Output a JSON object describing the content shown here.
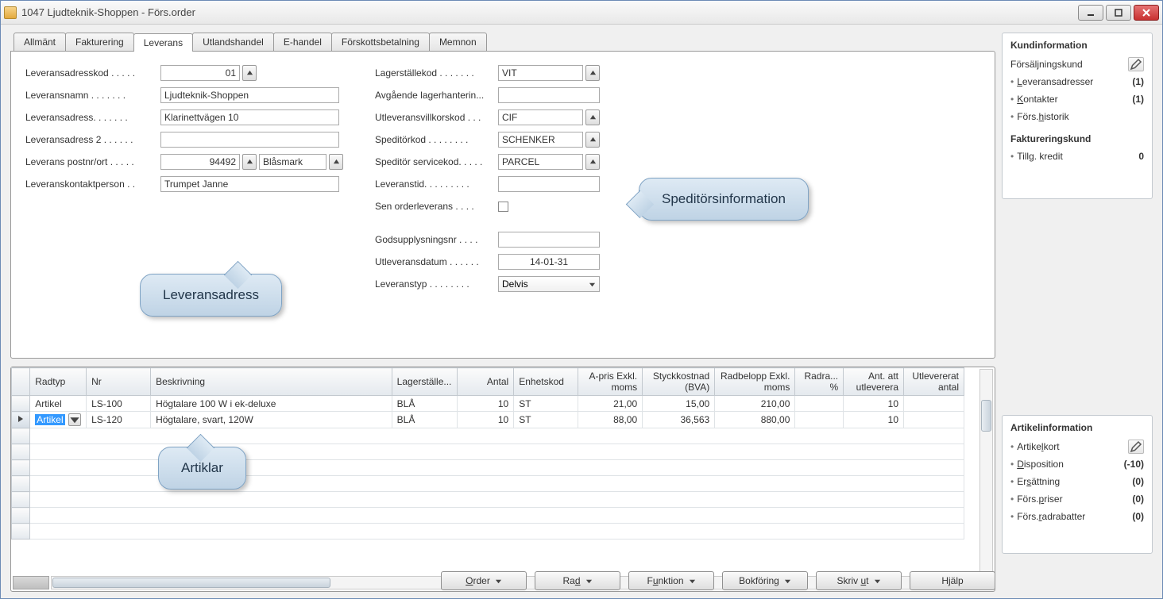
{
  "window": {
    "title": "1047 Ljudteknik-Shoppen - Förs.order"
  },
  "tabs": [
    "Allmänt",
    "Fakturering",
    "Leverans",
    "Utlandshandel",
    "E-handel",
    "Förskottsbetalning",
    "Memnon"
  ],
  "active_tab_index": 2,
  "form_left": {
    "leveransadresskod": {
      "label": "Leveransadresskod . . . . .",
      "value": "01"
    },
    "leveransnamn": {
      "label": "Leveransnamn . . . . . . .",
      "value": "Ljudteknik-Shoppen"
    },
    "leveransadress": {
      "label": "Leveransadress. . . . . . .",
      "value": "Klarinettvägen 10"
    },
    "leveransadress2": {
      "label": "Leveransadress 2 . . . . . .",
      "value": ""
    },
    "postnr": {
      "label": "Leverans postnr/ort . . . . .",
      "value": "94492",
      "ort": "Blåsmark"
    },
    "kontakt": {
      "label": "Leveranskontaktperson . .",
      "value": "Trumpet Janne"
    }
  },
  "form_right": {
    "lagerstallekod": {
      "label": "Lagerställekod  . . . . . . .",
      "value": "VIT"
    },
    "avg_lager": {
      "label": "Avgående lagerhanterin...",
      "value": ""
    },
    "utlev_villkor": {
      "label": "Utleveransvillkorskod  . . .",
      "value": "CIF"
    },
    "speditor": {
      "label": "Speditörkod  . . . . . . . .",
      "value": "SCHENKER"
    },
    "speditor_service": {
      "label": "Speditör servicekod. . . . .",
      "value": "PARCEL"
    },
    "leveranstid": {
      "label": "Leveranstid. . . . . . . . .",
      "value": ""
    },
    "sen_order": {
      "label": "Sen orderleverans  . . . .",
      "checked": false
    },
    "godsupplysning": {
      "label": "Godsupplysningsnr  . . . .",
      "value": ""
    },
    "utlev_datum": {
      "label": "Utleveransdatum . . . . . .",
      "value": "14-01-31"
    },
    "leveranstyp": {
      "label": "Leveranstyp  . . . . . . . .",
      "value": "Delvis"
    }
  },
  "bubbles": {
    "leverans": "Leveransadress",
    "speditor": "Speditörsinformation",
    "artiklar": "Artiklar"
  },
  "grid": {
    "headers": [
      "Radtyp",
      "Nr",
      "Beskrivning",
      "Lagerställe...",
      "Antal",
      "Enhetskod",
      "A-pris Exkl. moms",
      "Styckkostnad (BVA)",
      "Radbelopp Exkl. moms",
      "Radra... %",
      "Ant. att utleverera",
      "Utlevererat antal"
    ],
    "rows": [
      {
        "selected": false,
        "radtyp": "Artikel",
        "nr": "LS-100",
        "beskrivning": "Högtalare 100 W i ek-deluxe",
        "lager": "BLÅ",
        "antal": "10",
        "enhet": "ST",
        "apris": "21,00",
        "styck": "15,00",
        "radbelopp": "210,00",
        "radra": "",
        "att_utlev": "10",
        "utlev": ""
      },
      {
        "selected": true,
        "radtyp": "Artikel",
        "nr": "LS-120",
        "beskrivning": "Högtalare, svart, 120W",
        "lager": "BLÅ",
        "antal": "10",
        "enhet": "ST",
        "apris": "88,00",
        "styck": "36,563",
        "radbelopp": "880,00",
        "radra": "",
        "att_utlev": "10",
        "utlev": ""
      }
    ]
  },
  "buttons": {
    "order": "Order",
    "rad": "Rad",
    "funktion": "Funktion",
    "bokforing": "Bokföring",
    "skriv_ut": "Skriv ut",
    "hjalp": "Hjälp"
  },
  "side1": {
    "title": "Kundinformation",
    "sub1": "Försäljningskund",
    "rows1": [
      {
        "label": "Leveransadresser",
        "val": "(1)",
        "u": "L"
      },
      {
        "label": "Kontakter",
        "val": "(1)",
        "u": "K"
      },
      {
        "label": "Förs.historik",
        "val": "",
        "u": "h"
      }
    ],
    "sub2": "Faktureringskund",
    "rows2": [
      {
        "label": "Tillg. kredit",
        "val": "0"
      }
    ]
  },
  "side2": {
    "title": "Artikelinformation",
    "rows": [
      {
        "label": "Artikelkort",
        "val": "",
        "edit": true,
        "u": "l"
      },
      {
        "label": "Disposition",
        "val": "(-10)",
        "u": "D"
      },
      {
        "label": "Ersättning",
        "val": "(0)",
        "u": "s"
      },
      {
        "label": "Förs.priser",
        "val": "(0)",
        "u": "p"
      },
      {
        "label": "Förs.radrabatter",
        "val": "(0)",
        "u": "r"
      }
    ]
  }
}
